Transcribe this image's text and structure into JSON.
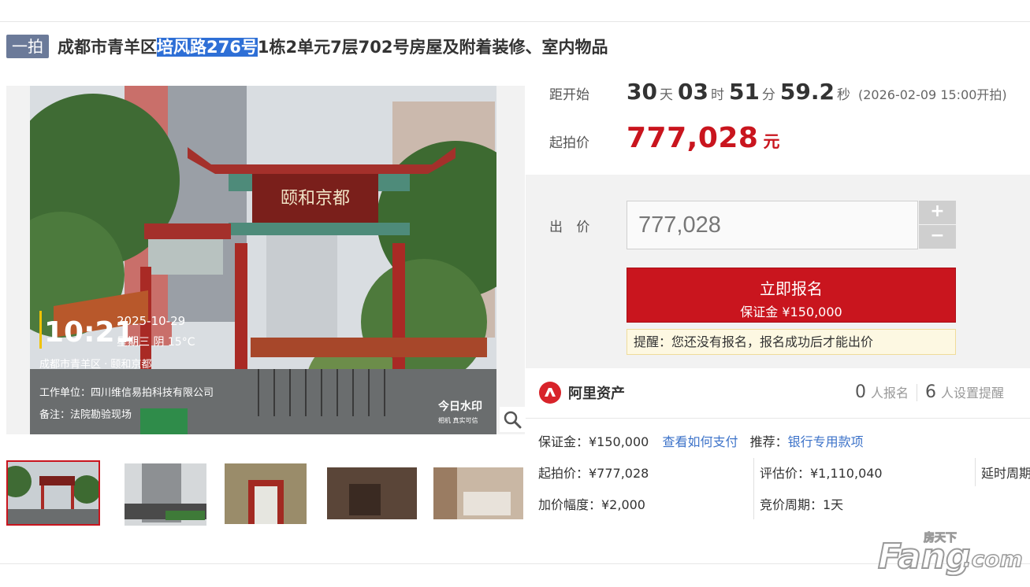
{
  "header": {
    "tag": "一拍",
    "title_pre": "成都市青羊区",
    "title_highlight": "培风路276号",
    "title_post": "1栋2单元7层702号房屋及附着装修、室内物品"
  },
  "gallery": {
    "photo_sign": "颐和京都",
    "photo_time": "10:21",
    "photo_date": "2025-10-29",
    "photo_weekday_weather": "星期三  阴 15°C",
    "photo_location": "成都市青羊区 · 颐和京都",
    "photo_work_unit": "工作单位：四川维信易拍科技有限公司",
    "photo_note": "备注：法院勘验现场",
    "photo_watermark": "今日水印",
    "photo_watermark_sub": "相机  真实可信",
    "selected_thumbnail": 1,
    "thumbnails": [
      "thumb-1",
      "thumb-2",
      "thumb-3",
      "thumb-4",
      "thumb-5"
    ]
  },
  "auction": {
    "countdown_label": "距开始",
    "days": "30",
    "days_unit": "天",
    "hours": "03",
    "hours_unit": "时",
    "minutes": "51",
    "minutes_unit": "分",
    "seconds": "59.2",
    "seconds_unit": "秒",
    "start_time": "(2026-02-09 15:00开拍)",
    "start_price_label": "起拍价",
    "start_price": "777,028",
    "start_price_unit": "元"
  },
  "bid": {
    "label": "出 价",
    "value": "777,028",
    "plus": "+",
    "minus": "−",
    "signup_label": "立即报名",
    "deposit_label": "保证金 ¥150,000",
    "reminder": "提醒：您还没有报名，报名成功后才能出价"
  },
  "platform": {
    "name": "阿里资产",
    "signup_count": "0",
    "signup_count_label": "人报名",
    "reminder_count": "6",
    "reminder_count_label": "人设置提醒"
  },
  "details": {
    "deposit": "保证金：¥150,000",
    "pay_link": "查看如何支付",
    "recommend_label": "推荐：",
    "recommend_link": "银行专用款项",
    "start_price": "起拍价：¥777,028",
    "appraisal": "评估价：¥1,110,040",
    "delay": "延时周期",
    "increment": "加价幅度：¥2,000",
    "bid_cycle": "竞价周期：1天"
  },
  "brand_watermark": {
    "main": "Fang",
    "sub": "房天下",
    "dotcom": ".com"
  },
  "colors": {
    "accent_red": "#c9151e",
    "link_blue": "#3d73c9",
    "tag_gray": "#6b7a99",
    "highlight_blue": "#2e6fd6"
  }
}
